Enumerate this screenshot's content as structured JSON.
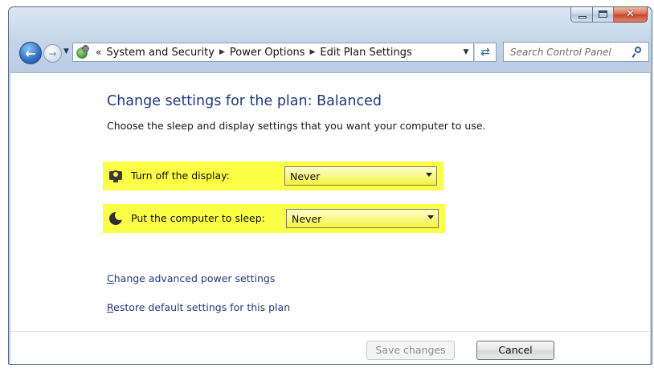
{
  "window": {
    "controls": {
      "minimize_icon": "minimize-icon",
      "maximize_icon": "maximize-icon",
      "close_icon": "close-icon",
      "close_glyph": "✕"
    }
  },
  "navigation": {
    "back_icon": "back-arrow-icon",
    "forward_icon": "forward-arrow-icon",
    "recent_icon": "recent-pages-dropdown-icon",
    "address_icon": "control-panel-icon",
    "overflow_glyph": "«",
    "breadcrumbs": [
      "System and Security",
      "Power Options",
      "Edit Plan Settings"
    ],
    "refresh_icon": "refresh-icon"
  },
  "search": {
    "placeholder": "Search Control Panel",
    "icon": "search-icon"
  },
  "page": {
    "title": "Change settings for the plan: Balanced",
    "description": "Choose the sleep and display settings that you want your computer to use.",
    "highlight_color": "#fbff45",
    "title_color": "#1e3b78"
  },
  "settings": {
    "display": {
      "icon": "monitor-icon",
      "label": "Turn off the display:",
      "value": "Never"
    },
    "sleep": {
      "icon": "sleep-icon",
      "label": "Put the computer to sleep:",
      "value": "Never"
    }
  },
  "links": {
    "advanced_first": "C",
    "advanced_rest": "hange advanced power settings",
    "restore_first": "R",
    "restore_rest": "estore default settings for this plan"
  },
  "buttons": {
    "save": {
      "label": "Save changes",
      "enabled": false
    },
    "cancel": {
      "label": "Cancel",
      "enabled": true
    }
  }
}
